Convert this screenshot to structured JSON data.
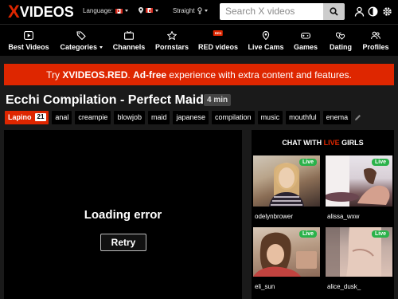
{
  "header": {
    "logo_x": "X",
    "logo_text": "VIDEOS",
    "language_label": "Language:",
    "orientation_label": "Straight",
    "search_placeholder": "Search X videos"
  },
  "nav": {
    "items": [
      {
        "label": "Best Videos",
        "icon": "play-square-icon"
      },
      {
        "label": "Categories",
        "icon": "tags-icon"
      },
      {
        "label": "Channels",
        "icon": "tv-icon"
      },
      {
        "label": "Pornstars",
        "icon": "star-icon"
      },
      {
        "label": "RED videos",
        "icon": "red-icon",
        "badge": "RED"
      },
      {
        "label": "Live Cams",
        "icon": "location-pin-icon"
      },
      {
        "label": "Games",
        "icon": "gamepad-icon"
      },
      {
        "label": "Dating",
        "icon": "hearts-icon"
      },
      {
        "label": "Profiles",
        "icon": "users-icon"
      }
    ]
  },
  "banner": {
    "pre": "Try ",
    "brand": "XVIDEOS.RED",
    "mid": ". ",
    "bold": "Ad-free",
    "post": " experience with extra content and features."
  },
  "video": {
    "title": "Ecchi Compilation - Perfect Maid",
    "duration": "4 min",
    "uploader": "Lapino",
    "uploader_count": "21",
    "tags": [
      "anal",
      "creampie",
      "blowjob",
      "maid",
      "japanese",
      "compilation",
      "music",
      "mouthful",
      "enema"
    ]
  },
  "player": {
    "error_text": "Loading error",
    "retry_label": "Retry"
  },
  "live_panel": {
    "heading_pre": "CHAT WITH ",
    "heading_live": "LIVE",
    "heading_post": " GIRLS",
    "badge": "Live",
    "cams": [
      {
        "name": "odelynbrower"
      },
      {
        "name": "alissa_wxw"
      },
      {
        "name": "eli_sun"
      },
      {
        "name": "alice_dusk_"
      }
    ]
  },
  "colors": {
    "accent": "#de2600",
    "live_green": "#2ab24a",
    "background": "#1a1a1a"
  }
}
